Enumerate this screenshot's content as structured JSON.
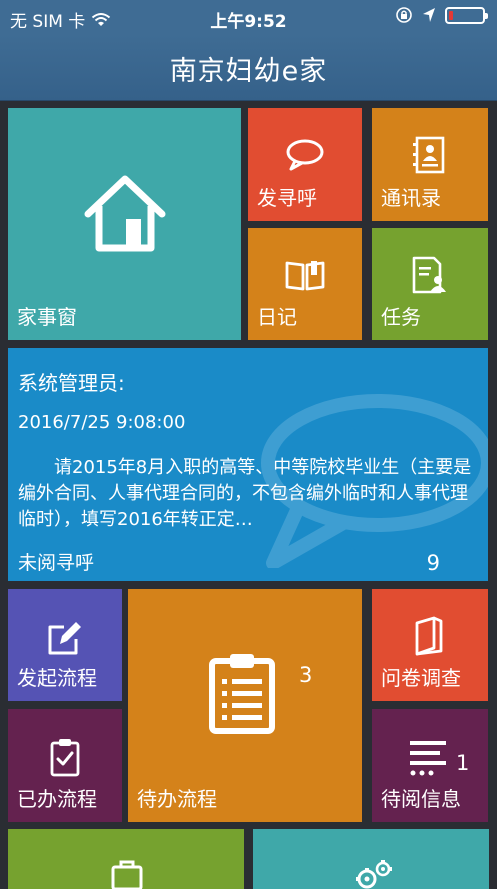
{
  "status_bar": {
    "carrier": "无 SIM 卡",
    "time": "上午9:52"
  },
  "header": {
    "title": "南京妇幼e家"
  },
  "tiles": {
    "jiashi": {
      "label": "家事窗",
      "icon": "house-icon"
    },
    "faxunhu": {
      "label": "发寻呼",
      "icon": "speech-bubble-icon"
    },
    "tongxun": {
      "label": "通讯录",
      "icon": "contact-book-icon"
    },
    "riji": {
      "label": "日记",
      "icon": "open-book-icon"
    },
    "renwu": {
      "label": "任务",
      "icon": "task-document-icon"
    },
    "faqi": {
      "label": "发起流程",
      "icon": "edit-icon"
    },
    "daiban": {
      "label": "待办流程",
      "icon": "clipboard-list-icon",
      "count": "3"
    },
    "wenjuan": {
      "label": "问卷调查",
      "icon": "survey-book-icon"
    },
    "yiban": {
      "label": "已办流程",
      "icon": "clipboard-check-icon"
    },
    "daiyue": {
      "label": "待阅信息",
      "icon": "list-lines-icon",
      "count": "1"
    }
  },
  "message": {
    "sender": "系统管理员:",
    "time": "2016/7/25 9:08:00",
    "body": "请2015年8月入职的高等、中等院校毕业生（主要是编外合同、人事代理合同的，不包含编外临时和人事代理临时），填写2016年转正定…",
    "unread_label": "未阅寻呼",
    "unread_count": "9"
  },
  "colors": {
    "header": "#3f6c94",
    "teal": "#3fa8a9",
    "red": "#e14d31",
    "orange": "#d4821a",
    "green": "#76a22f",
    "blue": "#1a8bc8",
    "indigo": "#5553b4",
    "purple": "#64224f"
  }
}
